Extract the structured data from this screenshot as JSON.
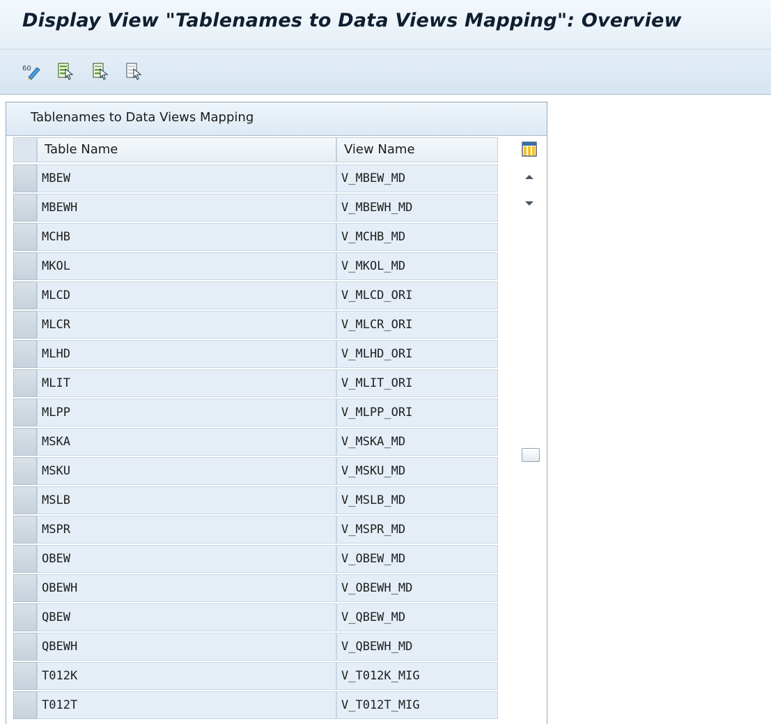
{
  "window": {
    "title": "Display View \"Tablenames to Data Views Mapping\": Overview"
  },
  "toolbar": {
    "buttons": [
      {
        "icon": "display-change-icon"
      },
      {
        "icon": "select-all-icon"
      },
      {
        "icon": "select-block-icon"
      },
      {
        "icon": "deselect-all-icon"
      }
    ]
  },
  "table": {
    "title": "Tablenames to Data Views Mapping",
    "columns": [
      "Table Name",
      "View Name"
    ],
    "rows": [
      {
        "table": "MBEW",
        "view": "V_MBEW_MD"
      },
      {
        "table": "MBEWH",
        "view": "V_MBEWH_MD"
      },
      {
        "table": "MCHB",
        "view": "V_MCHB_MD"
      },
      {
        "table": "MKOL",
        "view": "V_MKOL_MD"
      },
      {
        "table": "MLCD",
        "view": "V_MLCD_ORI"
      },
      {
        "table": "MLCR",
        "view": "V_MLCR_ORI"
      },
      {
        "table": "MLHD",
        "view": "V_MLHD_ORI"
      },
      {
        "table": "MLIT",
        "view": "V_MLIT_ORI"
      },
      {
        "table": "MLPP",
        "view": "V_MLPP_ORI"
      },
      {
        "table": "MSKA",
        "view": "V_MSKA_MD"
      },
      {
        "table": "MSKU",
        "view": "V_MSKU_MD"
      },
      {
        "table": "MSLB",
        "view": "V_MSLB_MD"
      },
      {
        "table": "MSPR",
        "view": "V_MSPR_MD"
      },
      {
        "table": "OBEW",
        "view": "V_OBEW_MD"
      },
      {
        "table": "OBEWH",
        "view": "V_OBEWH_MD"
      },
      {
        "table": "QBEW",
        "view": "V_QBEW_MD"
      },
      {
        "table": "QBEWH",
        "view": "V_QBEWH_MD"
      },
      {
        "table": "T012K",
        "view": "V_T012K_MIG"
      },
      {
        "table": "T012T",
        "view": "V_T012T_MIG"
      }
    ]
  },
  "colors": {
    "cell_bg": "#e5eef7",
    "header_bg": "#dde9f4",
    "toolbar_bg": "#d7e5f1"
  }
}
